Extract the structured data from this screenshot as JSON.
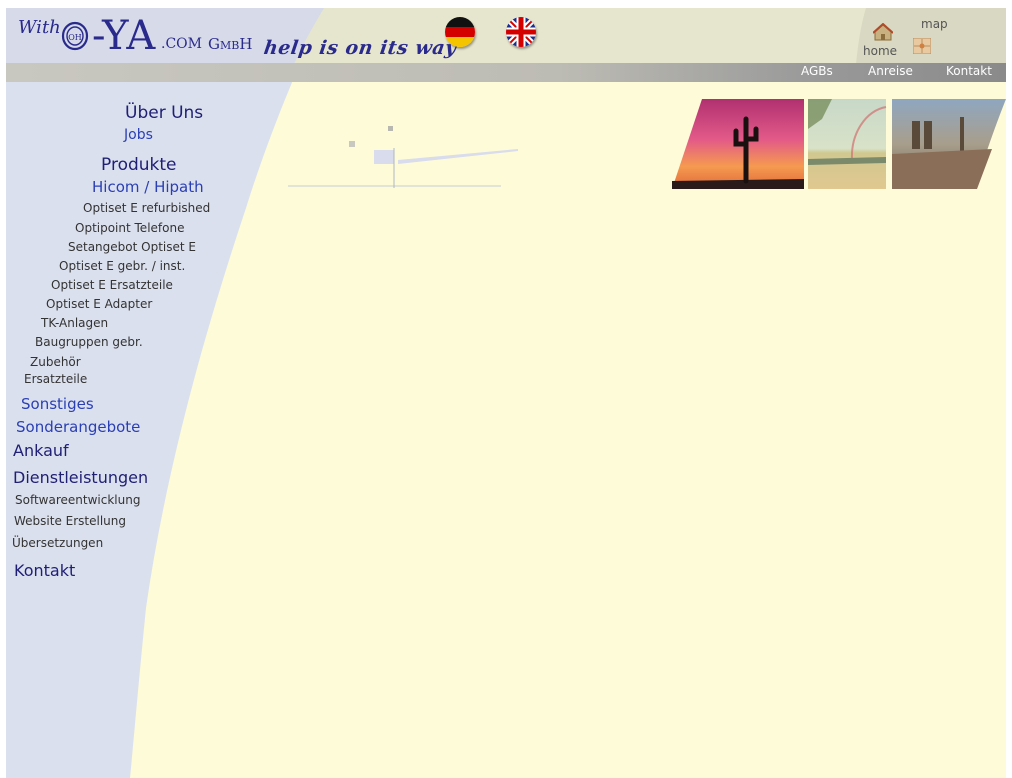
{
  "brand": {
    "with": "With",
    "logo_mark": "OH",
    "name": "-YA",
    "com": ".COM",
    "gmbh": "GmbH",
    "tagline": "help is on its way"
  },
  "flags": [
    {
      "icon": "german-flag-icon"
    },
    {
      "icon": "uk-flag-icon"
    }
  ],
  "header_links": {
    "home": "home",
    "map": "map"
  },
  "nav": {
    "items": [
      "AGBs",
      "Anreise",
      "Kontakt"
    ]
  },
  "sidebar": {
    "items": [
      {
        "label": "Über Uns",
        "level": 1
      },
      {
        "label": "Jobs",
        "level": 2
      },
      {
        "label": "Produkte",
        "level": 1
      },
      {
        "label": "Hicom / Hipath",
        "level": 2
      },
      {
        "label": "Optiset E refurbished",
        "level": 3
      },
      {
        "label": "Optipoint Telefone",
        "level": 3
      },
      {
        "label": "Setangebot Optiset E",
        "level": 3
      },
      {
        "label": "Optiset E gebr. / inst.",
        "level": 3
      },
      {
        "label": "Optiset E Ersatzteile",
        "level": 3
      },
      {
        "label": "Optiset E Adapter",
        "level": 3
      },
      {
        "label": "TK-Anlagen",
        "level": 3
      },
      {
        "label": "Baugruppen gebr.",
        "level": 3
      },
      {
        "label": "Zubehör",
        "level": 3
      },
      {
        "label": "Ersatzteile",
        "level": 3
      },
      {
        "label": "Sonstiges",
        "level": 2
      },
      {
        "label": "Sonderangebote",
        "level": 2
      },
      {
        "label": "Ankauf",
        "level": 1
      },
      {
        "label": "Dienstleistungen",
        "level": 1
      },
      {
        "label": "Softwareentwicklung",
        "level": 3
      },
      {
        "label": "Website Erstellung",
        "level": 3
      },
      {
        "label": "Übersetzungen",
        "level": 3
      },
      {
        "label": "Kontakt",
        "level": 1
      }
    ]
  },
  "photos": [
    {
      "icon": "desert-sunset-photo"
    },
    {
      "icon": "rainbow-lake-photo"
    },
    {
      "icon": "munich-city-photo"
    }
  ],
  "colors": {
    "background": "#fefbd8",
    "sidebar_band": "#dbe0ee",
    "header_band": "#e6e5cd",
    "nav_bar": "#9c9c9c",
    "menu_dark": "#1f1f74",
    "menu_blue": "#2a3fb4",
    "menu_text": "#333333"
  }
}
